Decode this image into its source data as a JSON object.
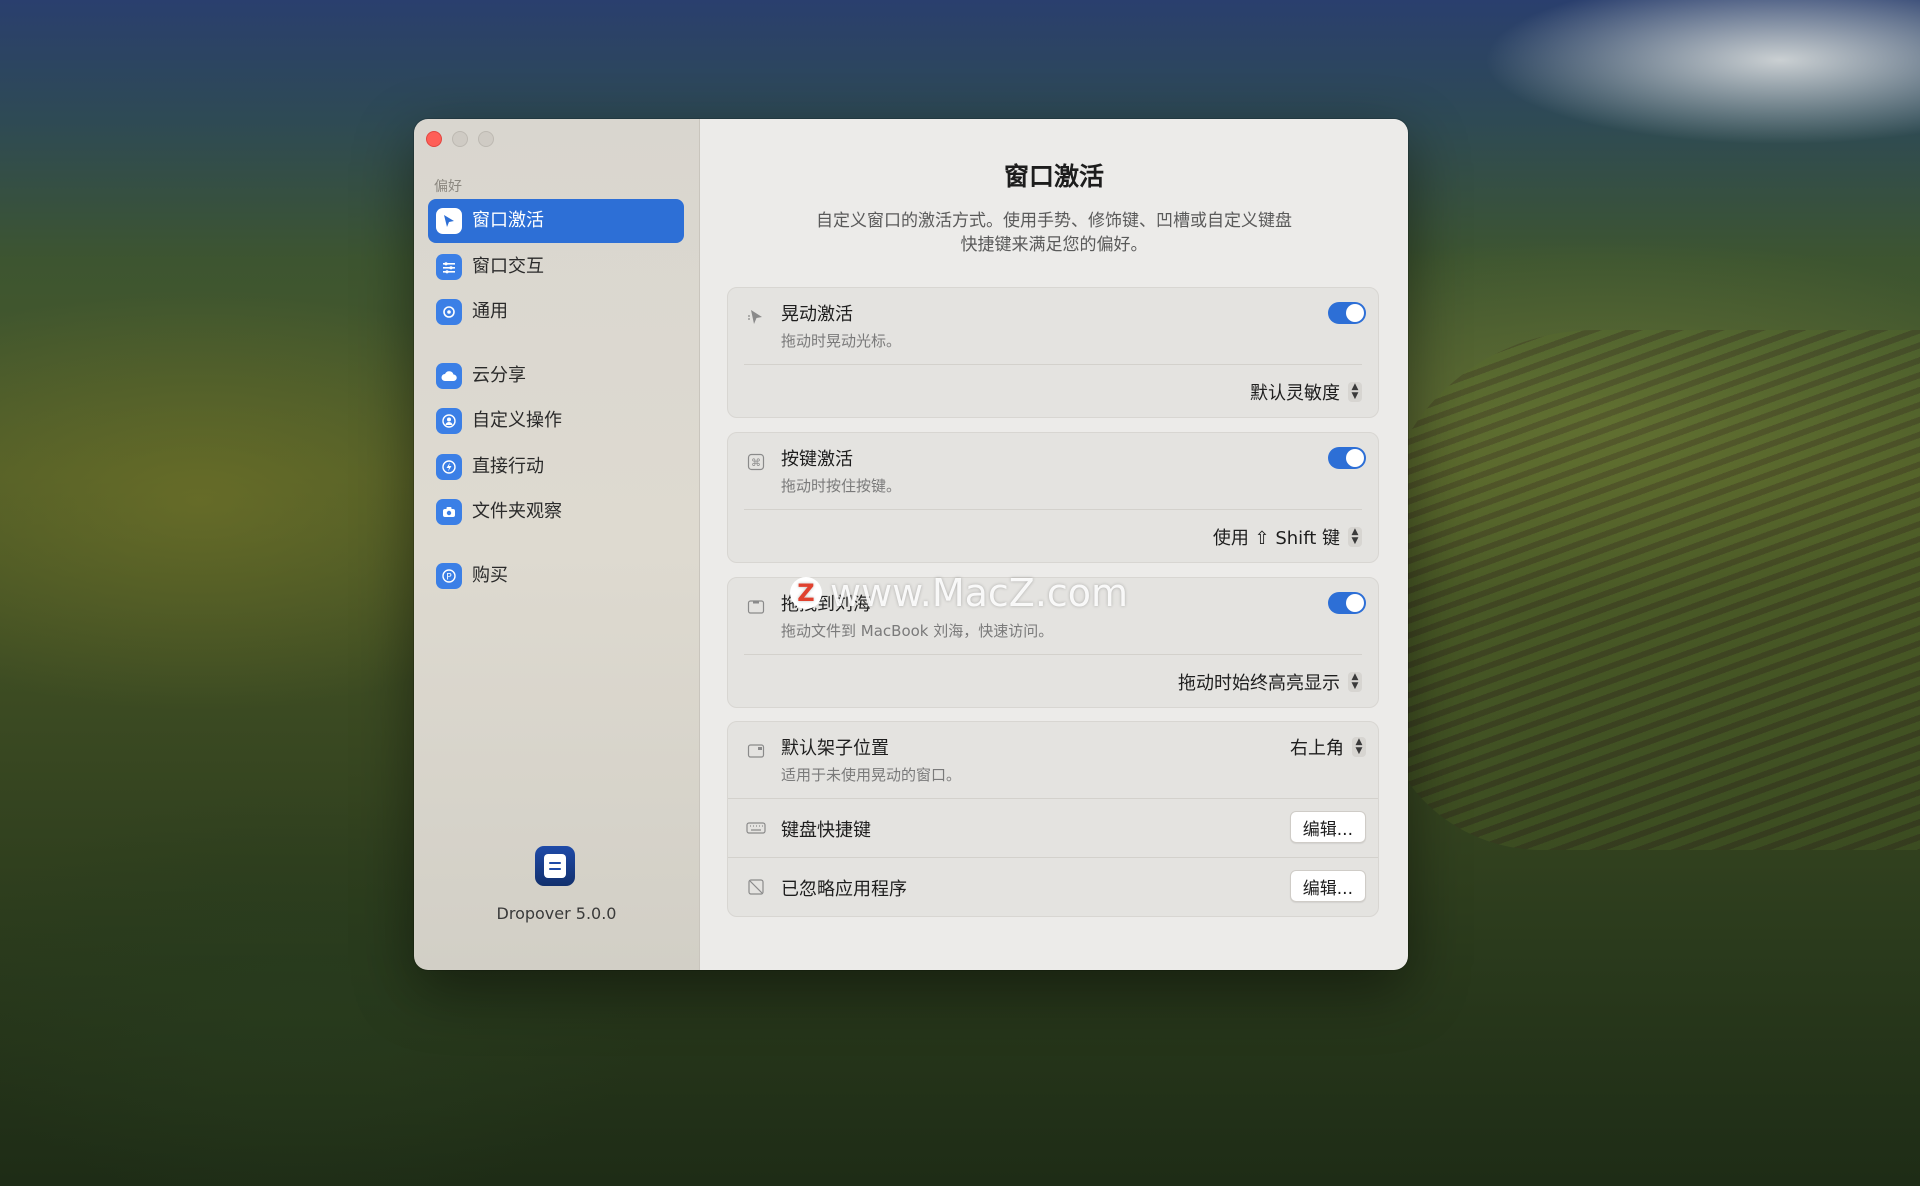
{
  "sidebar": {
    "section_label": "偏好",
    "items": [
      {
        "label": "窗口激活",
        "icon": "cursor-icon"
      },
      {
        "label": "窗口交互",
        "icon": "sliders-icon"
      },
      {
        "label": "通用",
        "icon": "gear-icon"
      },
      {
        "label": "云分享",
        "icon": "cloud-icon"
      },
      {
        "label": "自定义操作",
        "icon": "person-icon"
      },
      {
        "label": "直接行动",
        "icon": "bolt-icon"
      },
      {
        "label": "文件夹观察",
        "icon": "camera-icon"
      },
      {
        "label": "购买",
        "icon": "purchase-icon"
      }
    ],
    "app_version": "Dropover 5.0.0"
  },
  "main": {
    "title": "窗口激活",
    "description": "自定义窗口的激活方式。使用手势、修饰键、凹槽或自定义键盘快捷键来满足您的偏好。",
    "shake": {
      "title": "晃动激活",
      "desc": "拖动时晃动光标。",
      "enabled": true,
      "option": "默认灵敏度"
    },
    "key": {
      "title": "按键激活",
      "desc": "拖动时按住按键。",
      "enabled": true,
      "option": "使用 ⇧ Shift 键"
    },
    "notch": {
      "title": "拖拽到刘海",
      "desc": "拖动文件到 MacBook 刘海，快速访问。",
      "enabled": true,
      "option": "拖动时始终高亮显示"
    },
    "shelf_position": {
      "title": "默认架子位置",
      "desc": "适用于未使用晃动的窗口。",
      "option": "右上角"
    },
    "keyboard_shortcut": {
      "title": "键盘快捷键",
      "button": "编辑..."
    },
    "ignored_apps": {
      "title": "已忽略应用程序",
      "button": "编辑..."
    }
  },
  "watermark": "www.MacZ.com",
  "colors": {
    "accent": "#2d6fd6",
    "close": "#fe5f57"
  }
}
